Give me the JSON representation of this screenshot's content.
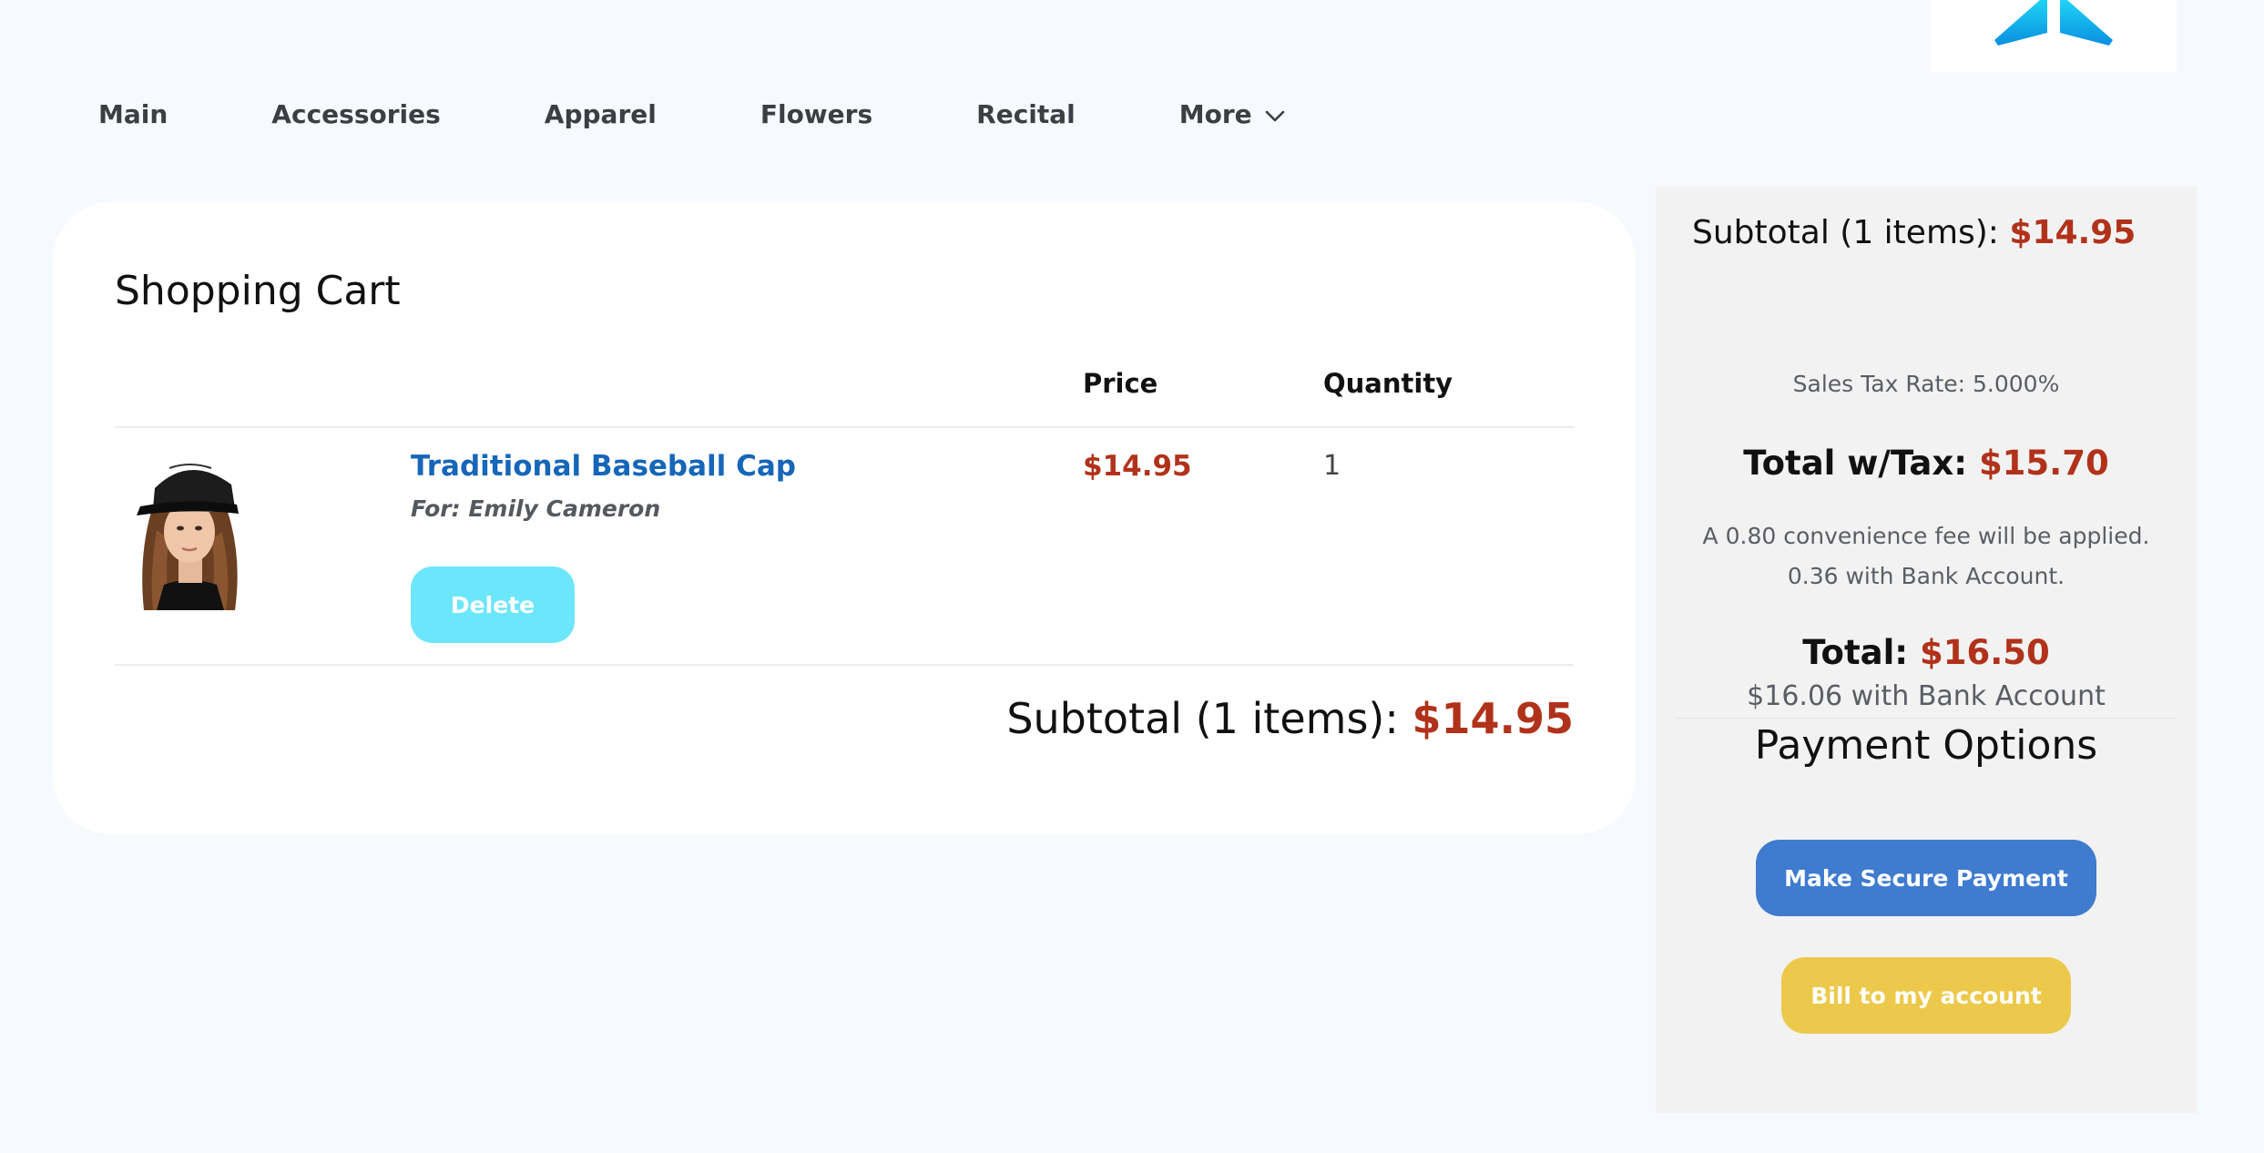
{
  "nav": {
    "items": [
      {
        "label": "Main"
      },
      {
        "label": "Accessories"
      },
      {
        "label": "Apparel"
      },
      {
        "label": "Flowers"
      },
      {
        "label": "Recital"
      },
      {
        "label": "More"
      }
    ]
  },
  "cart": {
    "title": "Shopping Cart",
    "columns": {
      "price": "Price",
      "quantity": "Quantity"
    },
    "items": [
      {
        "name": "Traditional Baseball Cap",
        "for_label": "For: Emily Cameron",
        "price": "$14.95",
        "quantity": "1",
        "delete_label": "Delete"
      }
    ],
    "subtotal_label": "Subtotal (1 items):",
    "subtotal_value": "$14.95"
  },
  "summary": {
    "subtotal_label": "Subtotal (1 items):",
    "subtotal_value": "$14.95",
    "tax_rate": "Sales Tax Rate: 5.000%",
    "total_tax_label": "Total w/Tax:",
    "total_tax_value": "$15.70",
    "fee_line1": "A 0.80 convenience fee will be applied.",
    "fee_line2": "0.36 with Bank Account.",
    "total_label": "Total:",
    "total_value": "$16.50",
    "bank_total": "$16.06 with Bank Account",
    "payment_title": "Payment Options",
    "secure_payment_label": "Make Secure Payment",
    "bill_account_label": "Bill to my account"
  },
  "colors": {
    "accent_red": "#b1321a",
    "link_blue": "#1666b9",
    "delete_cyan": "#6ce6fb",
    "pay_blue": "#3f7bcf",
    "bill_yellow": "#ecc94a"
  },
  "icons": {
    "logo": "brand-logo-icon",
    "more": "chevron-down-icon"
  }
}
